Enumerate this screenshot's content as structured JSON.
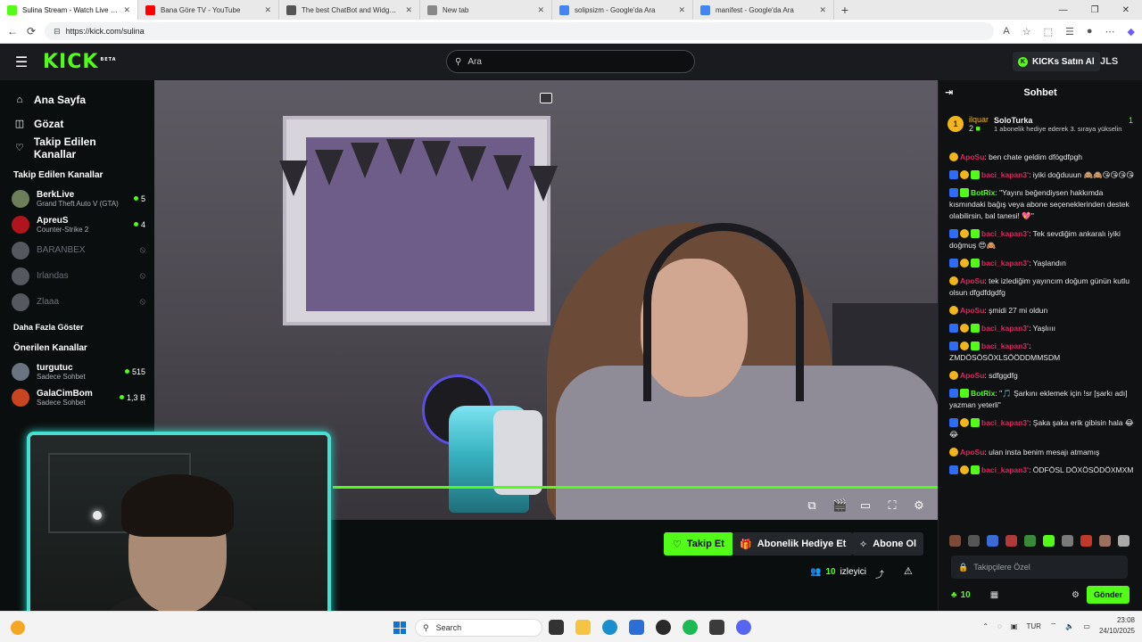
{
  "browser": {
    "tabs": [
      {
        "title": "Sulina Stream - Watch Live on Kick",
        "active": true,
        "color": "#53fc18"
      },
      {
        "title": "Bana Göre TV - YouTube",
        "active": false,
        "color": "#ff0000"
      },
      {
        "title": "The best ChatBot and Widgets for",
        "active": false,
        "color": "#555555"
      },
      {
        "title": "New tab",
        "active": false,
        "color": "#888888"
      },
      {
        "title": "solipsizm - Google'da Ara",
        "active": false,
        "color": "#4285f4"
      },
      {
        "title": "manifest - Google'da Ara",
        "active": false,
        "color": "#4285f4"
      }
    ],
    "url": "https://kick.com/sulina"
  },
  "header": {
    "logo": "KICK",
    "logo_sup": "BETA",
    "search_placeholder": "Ara",
    "kicks_label": "KICKs Satın Al",
    "user_initials": "JLS"
  },
  "sidebar": {
    "nav": [
      {
        "label": "Ana Sayfa",
        "icon": "home-icon"
      },
      {
        "label": "Gözat",
        "icon": "browse-icon"
      },
      {
        "label": "Takip Edilen Kanallar",
        "icon": "heart-icon"
      }
    ],
    "followed_title": "Takip Edilen Kanallar",
    "followed": [
      {
        "name": "BerkLive",
        "game": "Grand Theft Auto V (GTA)",
        "viewers": "5",
        "live": true,
        "color": "#6d7f5a"
      },
      {
        "name": "ApreuS",
        "game": "Counter-Strike 2",
        "viewers": "4",
        "live": true,
        "color": "#b0141d"
      },
      {
        "name": "BARANBEX",
        "game": "",
        "viewers": "",
        "live": false,
        "color": "#55595f"
      },
      {
        "name": "Irlandas",
        "game": "",
        "viewers": "",
        "live": false,
        "color": "#55595f"
      },
      {
        "name": "Zlaaa",
        "game": "",
        "viewers": "",
        "live": false,
        "color": "#55595f"
      }
    ],
    "show_more": "Daha Fazla Göster",
    "recommended_title": "Önerilen Kanallar",
    "recommended": [
      {
        "name": "turgutuc",
        "game": "Sadece Sohbet",
        "viewers": "515",
        "color": "#6a7480"
      },
      {
        "name": "GalaCimBom",
        "game": "Sadece Sohbet",
        "viewers": "1,3 B",
        "color": "#c8451f"
      }
    ]
  },
  "stream": {
    "follow_label": "Takip Et",
    "gift_label": "Abonelik Hediye Et",
    "subscribe_label": "Abone Ol",
    "viewer_count": "10",
    "viewer_label": "izleyici",
    "progress": 1.0
  },
  "chat": {
    "title": "Sohbet",
    "pinned": {
      "user": "ilquar",
      "sub_count": "2",
      "gifter": "SoloTurka",
      "gifter_count": "1",
      "text": "1 abonelik hediye ederek 3. sıraya yükselin"
    },
    "messages": [
      {
        "user": "ApoSu",
        "color": "#e0245e",
        "badges": [
          "gold"
        ],
        "text": "ben chate geldim dfögdfpgh"
      },
      {
        "user": "baci_kapan3'",
        "color": "#e0245e",
        "badges": [
          "blue",
          "gold",
          "green"
        ],
        "text": "iyiki doğduuun 🙈🙈😘😘😘😘"
      },
      {
        "user": "BotRix",
        "color": "#53fc18",
        "badges": [
          "blue",
          "green"
        ],
        "text": "\"Yayını beğendiysen hakkımda kısmındaki bağış veya abone seçeneklerinden destek olabilirsin, bal tanesi! 💖\""
      },
      {
        "user": "baci_kapan3'",
        "color": "#e0245e",
        "badges": [
          "blue",
          "gold",
          "green"
        ],
        "text": "Tek sevdiğim ankaralı iyiki doğmuş 😍🙈"
      },
      {
        "user": "baci_kapan3'",
        "color": "#e0245e",
        "badges": [
          "blue",
          "gold",
          "green"
        ],
        "text": "Yaşlandın"
      },
      {
        "user": "ApoSu",
        "color": "#e0245e",
        "badges": [
          "gold"
        ],
        "text": "tek izlediğim yayıncım doğum günün kutlu olsun dfgdfdgdfg"
      },
      {
        "user": "ApoSu",
        "color": "#e0245e",
        "badges": [
          "gold"
        ],
        "text": "şmidi 27 mi oldun"
      },
      {
        "user": "baci_kapan3'",
        "color": "#e0245e",
        "badges": [
          "blue",
          "gold",
          "green"
        ],
        "text": "Yaşlıııı"
      },
      {
        "user": "baci_kapan3'",
        "color": "#e0245e",
        "badges": [
          "blue",
          "gold",
          "green"
        ],
        "text": "ZMDÖSÖSÖXLSÖÖDDMMSDM"
      },
      {
        "user": "ApoSu",
        "color": "#e0245e",
        "badges": [
          "gold"
        ],
        "text": "sdfggdfg"
      },
      {
        "user": "BotRix",
        "color": "#53fc18",
        "badges": [
          "blue",
          "green"
        ],
        "text": "\"🎵 Şarkını eklemek için !sr [şarkı adı] yazman yeterli\""
      },
      {
        "user": "baci_kapan3'",
        "color": "#e0245e",
        "badges": [
          "blue",
          "gold",
          "green"
        ],
        "text": "Şaka şaka erik gibisin hala 😂😂"
      },
      {
        "user": "ApoSu",
        "color": "#e0245e",
        "badges": [
          "gold"
        ],
        "text": "ulan insta benim mesajı atmamış"
      },
      {
        "user": "baci_kapan3'",
        "color": "#e0245e",
        "badges": [
          "blue",
          "gold",
          "green"
        ],
        "text": "ÖDFÖSL DÖXÖSÖDÖXMXM"
      }
    ],
    "input_placeholder": "Takipçilere Özel",
    "points": "10",
    "send_label": "Gönder"
  },
  "taskbar": {
    "search_label": "Search",
    "lang": "TUR",
    "time": "23:08",
    "date": "24/10/2025"
  }
}
